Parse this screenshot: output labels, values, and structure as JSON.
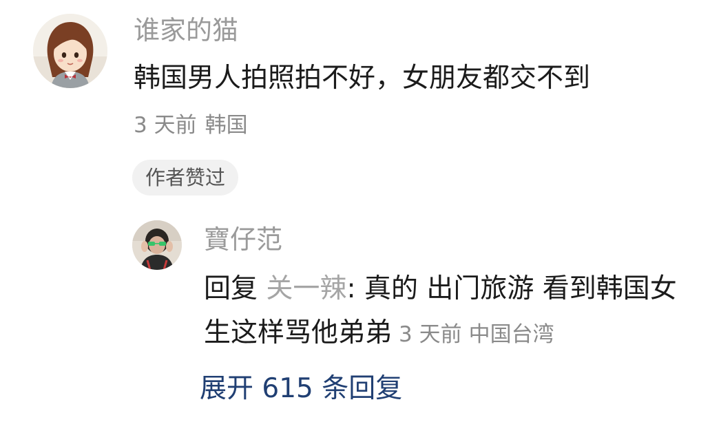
{
  "comment": {
    "username": "谁家的猫",
    "text": "韩国男人拍照拍不好，女朋友都交不到",
    "time": "3 天前",
    "location": "韩国",
    "author_liked_label": "作者赞过"
  },
  "reply": {
    "username": "寶仔范",
    "reply_prefix": "回复",
    "mention": "关一辣",
    "separator": ":",
    "text": " 真的 出门旅游 看到韩国女生这样骂他弟弟",
    "time": "3 天前",
    "location": "中国台湾"
  },
  "expand": {
    "label": "展开 615 条回复"
  }
}
